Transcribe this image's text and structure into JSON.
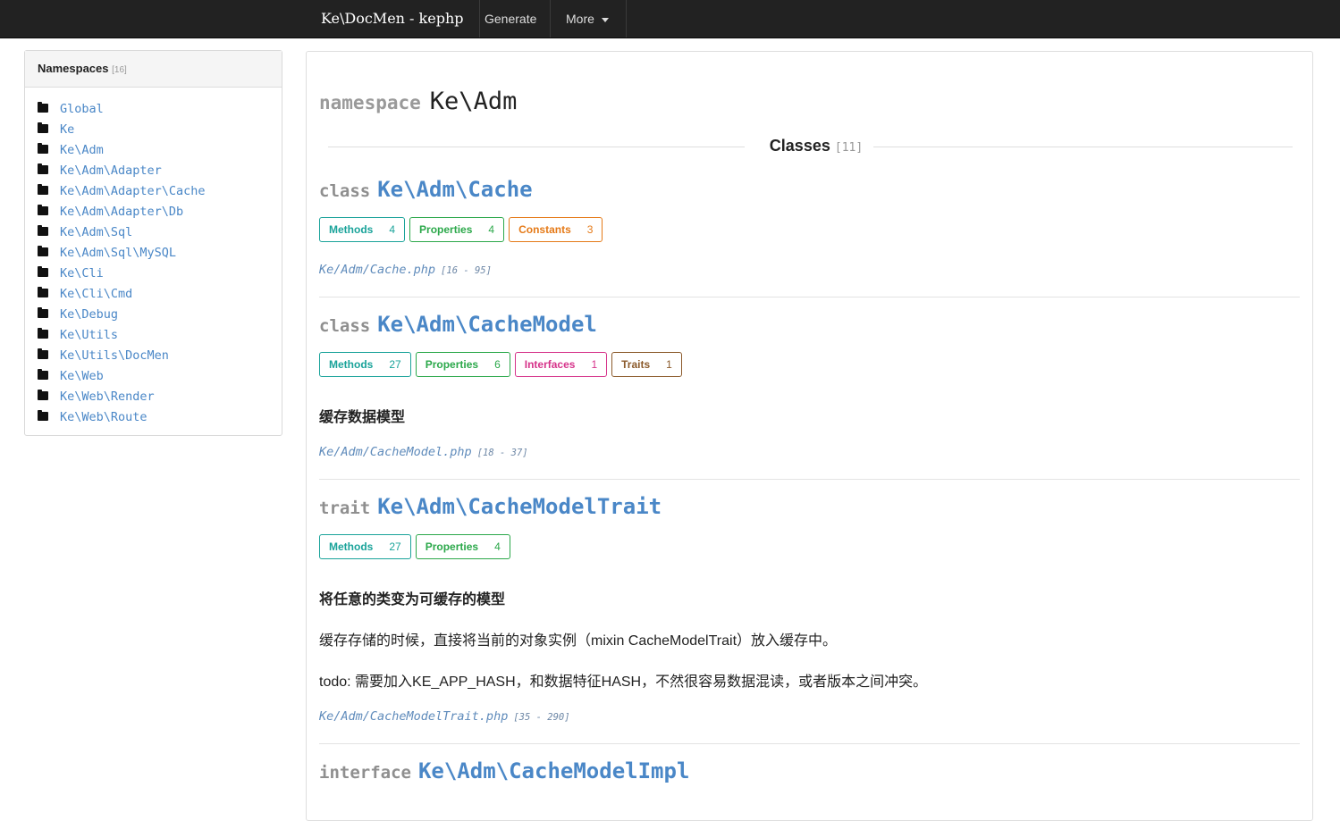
{
  "navbar": {
    "brand": "Ke\\DocMen - kephp",
    "generate": "Generate",
    "more": "More"
  },
  "sidebar": {
    "title": "Namespaces",
    "count": "[16]",
    "items": [
      "Global",
      "Ke",
      "Ke\\Adm",
      "Ke\\Adm\\Adapter",
      "Ke\\Adm\\Adapter\\Cache",
      "Ke\\Adm\\Adapter\\Db",
      "Ke\\Adm\\Sql",
      "Ke\\Adm\\Sql\\MySQL",
      "Ke\\Cli",
      "Ke\\Cli\\Cmd",
      "Ke\\Debug",
      "Ke\\Utils",
      "Ke\\Utils\\DocMen",
      "Ke\\Web",
      "Ke\\Web\\Render",
      "Ke\\Web\\Route"
    ]
  },
  "main": {
    "keyword": "namespace",
    "namespace": "Ke\\Adm",
    "classes_label": "Classes",
    "classes_count": "[11]",
    "entries": [
      {
        "kind": "class",
        "name": "Ke\\Adm\\Cache",
        "tags": [
          {
            "label": "Methods",
            "count": "4"
          },
          {
            "label": "Properties",
            "count": "4"
          },
          {
            "label": "Constants",
            "count": "3"
          }
        ],
        "file": "Ke/Adm/Cache.php",
        "range": "[16 - 95]"
      },
      {
        "kind": "class",
        "name": "Ke\\Adm\\CacheModel",
        "tags": [
          {
            "label": "Methods",
            "count": "27"
          },
          {
            "label": "Properties",
            "count": "6"
          },
          {
            "label": "Interfaces",
            "count": "1"
          },
          {
            "label": "Traits",
            "count": "1"
          }
        ],
        "summary": "缓存数据模型",
        "file": "Ke/Adm/CacheModel.php",
        "range": "[18 - 37]"
      },
      {
        "kind": "trait",
        "name": "Ke\\Adm\\CacheModelTrait",
        "tags": [
          {
            "label": "Methods",
            "count": "27"
          },
          {
            "label": "Properties",
            "count": "4"
          }
        ],
        "summary": "将任意的类变为可缓存的模型",
        "desc1": "缓存存储的时候，直接将当前的对象实例（mixin CacheModelTrait）放入缓存中。",
        "desc2": "todo: 需要加入KE_APP_HASH，和数据特征HASH，不然很容易数据混读，或者版本之间冲突。",
        "file": "Ke/Adm/CacheModelTrait.php",
        "range": "[35 - 290]"
      },
      {
        "kind": "interface",
        "name": "Ke\\Adm\\CacheModelImpl"
      }
    ]
  },
  "colors": {
    "link": "#4a87c7",
    "methods": "#1aa39a",
    "properties": "#2ba84a",
    "constants": "#e57a18",
    "interfaces": "#d6338a",
    "traits": "#8b5a2b",
    "navbar": "#222222"
  }
}
